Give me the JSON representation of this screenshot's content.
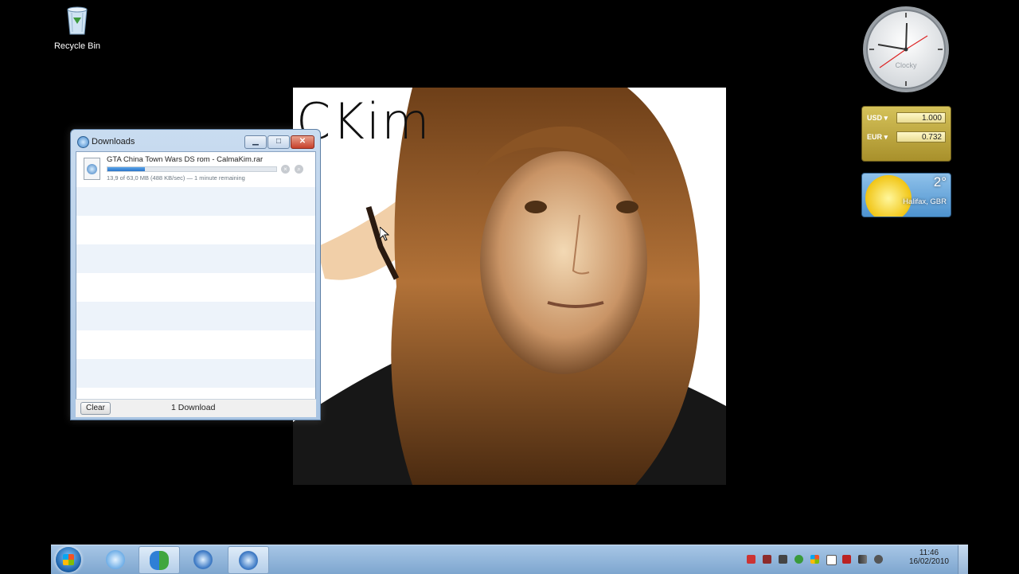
{
  "desktop": {
    "recycle_bin_label": "Recycle Bin",
    "wallpaper_text": "CKim"
  },
  "downloads_window": {
    "title": "Downloads",
    "items": [
      {
        "filename": "GTA China Town Wars DS rom - CalmaKim.rar",
        "status": "13,9 of 63,0 MB (488 KB/sec) — 1 minute remaining",
        "progress_fraction": 0.22
      }
    ],
    "clear_label": "Clear",
    "count_label": "1 Download"
  },
  "gadgets": {
    "clock_brand": "Clocky",
    "currency": {
      "from_code": "USD",
      "from_value": "1.000",
      "to_code": "EUR",
      "to_value": "0.732"
    },
    "weather": {
      "temperature": "2°",
      "location": "Halifax, GBR"
    }
  },
  "taskbar": {
    "time": "11:46",
    "date": "16/02/2010",
    "pinned": [
      {
        "name": "itunes-icon",
        "active": false
      },
      {
        "name": "messenger-icon",
        "active": true
      },
      {
        "name": "safari-icon",
        "active": false
      },
      {
        "name": "safari-icon",
        "active": true
      }
    ]
  }
}
